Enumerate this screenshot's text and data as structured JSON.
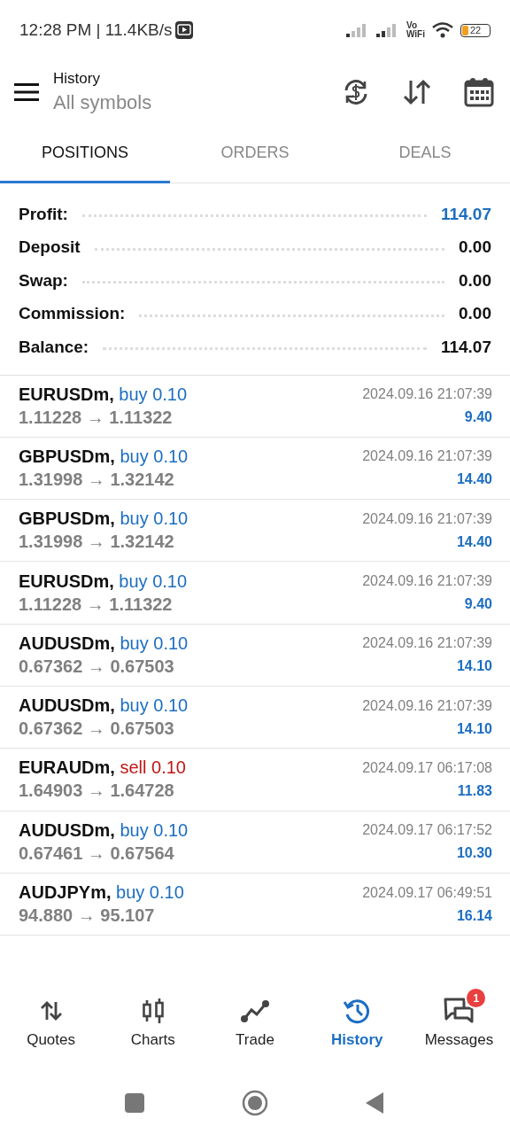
{
  "status_bar": {
    "time": "12:28 PM | 11.4KB/s",
    "network_top": "Vo",
    "network_bottom": "WiFi",
    "battery": "22"
  },
  "header": {
    "title": "History",
    "subtitle": "All symbols"
  },
  "tabs": [
    {
      "label": "POSITIONS",
      "selected": true
    },
    {
      "label": "ORDERS",
      "selected": false
    },
    {
      "label": "DEALS",
      "selected": false
    }
  ],
  "summary": [
    {
      "label": "Profit:",
      "value": "114.07",
      "kind": "profit"
    },
    {
      "label": "Deposit",
      "value": "0.00",
      "kind": "plain"
    },
    {
      "label": "Swap:",
      "value": "0.00",
      "kind": "plain"
    },
    {
      "label": "Commission:",
      "value": "0.00",
      "kind": "plain"
    },
    {
      "label": "Balance:",
      "value": "114.07",
      "kind": "plain"
    }
  ],
  "positions": [
    {
      "symbol": "EURUSDm,",
      "kind": "buy",
      "type": "buy 0.10",
      "prices": "1.11228 → 1.11322",
      "time": "2024.09.16 21:07:39",
      "profit": "9.40"
    },
    {
      "symbol": "GBPUSDm,",
      "kind": "buy",
      "type": "buy 0.10",
      "prices": "1.31998 → 1.32142",
      "time": "2024.09.16 21:07:39",
      "profit": "14.40"
    },
    {
      "symbol": "GBPUSDm,",
      "kind": "buy",
      "type": "buy 0.10",
      "prices": "1.31998 → 1.32142",
      "time": "2024.09.16 21:07:39",
      "profit": "14.40"
    },
    {
      "symbol": "EURUSDm,",
      "kind": "buy",
      "type": "buy 0.10",
      "prices": "1.11228 → 1.11322",
      "time": "2024.09.16 21:07:39",
      "profit": "9.40"
    },
    {
      "symbol": "AUDUSDm,",
      "kind": "buy",
      "type": "buy 0.10",
      "prices": "0.67362 → 0.67503",
      "time": "2024.09.16 21:07:39",
      "profit": "14.10"
    },
    {
      "symbol": "AUDUSDm,",
      "kind": "buy",
      "type": "buy 0.10",
      "prices": "0.67362 → 0.67503",
      "time": "2024.09.16 21:07:39",
      "profit": "14.10"
    },
    {
      "symbol": "EURAUDm,",
      "kind": "sell",
      "type": "sell 0.10",
      "prices": "1.64903 → 1.64728",
      "time": "2024.09.17 06:17:08",
      "profit": "11.83"
    },
    {
      "symbol": "AUDUSDm,",
      "kind": "buy",
      "type": "buy 0.10",
      "prices": "0.67461 → 0.67564",
      "time": "2024.09.17 06:17:52",
      "profit": "10.30"
    },
    {
      "symbol": "AUDJPYm,",
      "kind": "buy",
      "type": "buy 0.10",
      "prices": "94.880 → 95.107",
      "time": "2024.09.17 06:49:51",
      "profit": "16.14"
    }
  ],
  "bottom_nav": [
    {
      "label": "Quotes",
      "selected": false
    },
    {
      "label": "Charts",
      "selected": false
    },
    {
      "label": "Trade",
      "selected": false
    },
    {
      "label": "History",
      "selected": true
    },
    {
      "label": "Messages",
      "selected": false,
      "badge": "1"
    }
  ]
}
